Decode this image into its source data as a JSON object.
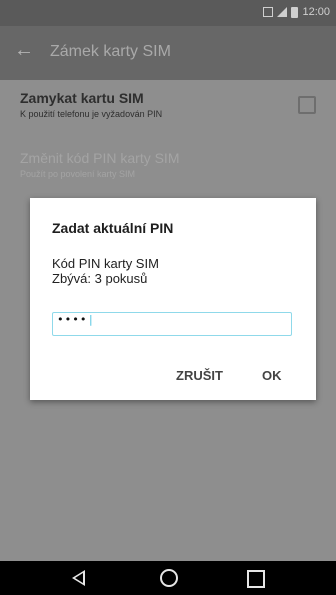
{
  "status_bar": {
    "time": "12:00"
  },
  "app_bar": {
    "title": "Zámek karty SIM"
  },
  "settings": {
    "lock_sim": {
      "title": "Zamykat kartu SIM",
      "summary": "K použití telefonu je vyžadován PIN"
    },
    "change_pin": {
      "title": "Změnit kód PIN karty SIM",
      "summary": "Použít po povolení karty SIM"
    }
  },
  "dialog": {
    "title": "Zadat aktuální PIN",
    "message_line1": "Kód PIN karty SIM",
    "message_line2": "Zbývá: 3 pokusů",
    "pin_value": "••••",
    "cancel_label": "ZRUŠIT",
    "ok_label": "OK"
  },
  "colors": {
    "accent": "#8fd9ea"
  }
}
